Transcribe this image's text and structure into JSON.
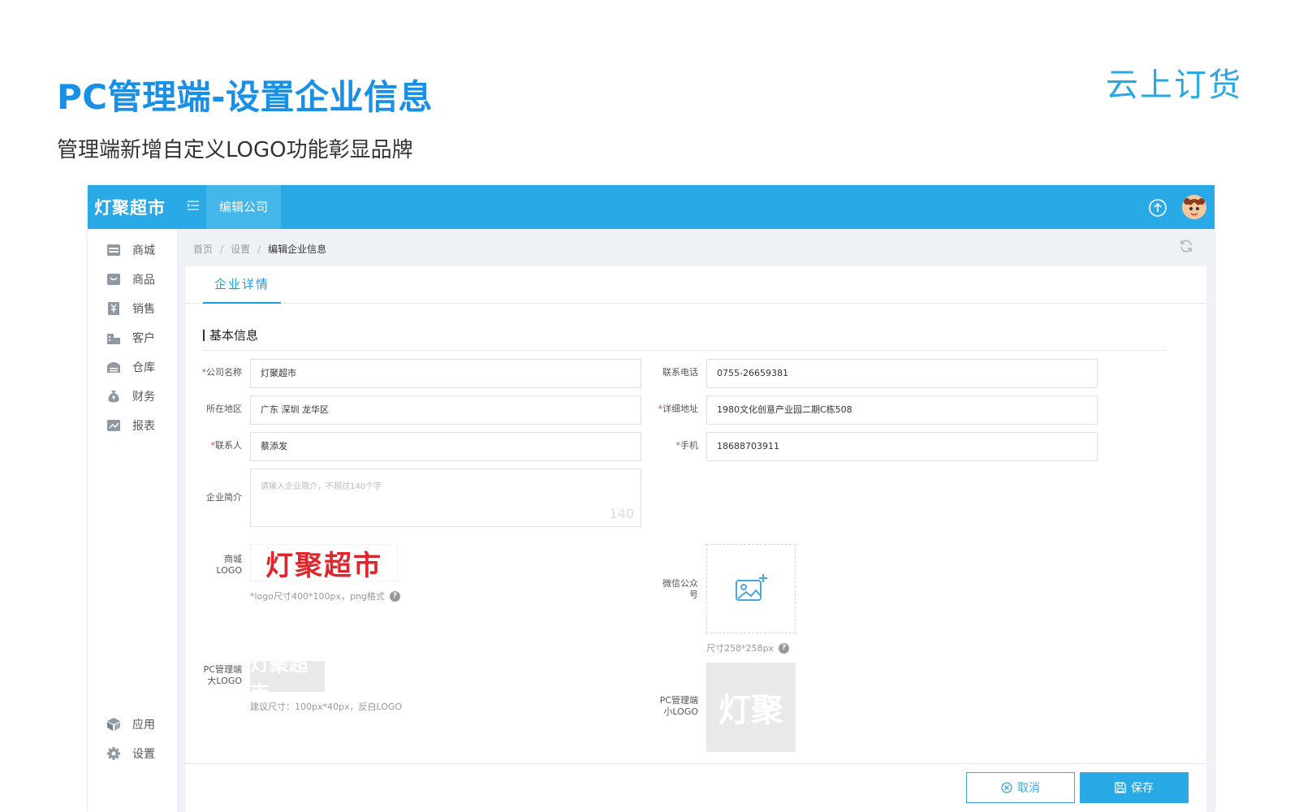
{
  "slide": {
    "title": "PC管理端-设置企业信息",
    "subtitle": "管理端新增自定义LOGO功能彰显品牌",
    "brand": "云上订货"
  },
  "topbar": {
    "app_name": "灯聚超市",
    "active_tab": "编辑公司"
  },
  "sidebar": {
    "items": [
      {
        "label": "商城",
        "icon": "shop-icon"
      },
      {
        "label": "商品",
        "icon": "goods-icon"
      },
      {
        "label": "销售",
        "icon": "sales-icon"
      },
      {
        "label": "客户",
        "icon": "customer-icon"
      },
      {
        "label": "仓库",
        "icon": "warehouse-icon"
      },
      {
        "label": "财务",
        "icon": "finance-icon"
      },
      {
        "label": "报表",
        "icon": "report-icon"
      }
    ],
    "bottom_items": [
      {
        "label": "应用",
        "icon": "apps-icon"
      },
      {
        "label": "设置",
        "icon": "settings-icon"
      }
    ]
  },
  "breadcrumb": {
    "home": "首页",
    "settings": "设置",
    "current": "编辑企业信息"
  },
  "tabs": {
    "detail": "企业详情"
  },
  "section": {
    "title": "基本信息"
  },
  "form": {
    "company_name": {
      "label": "公司名称",
      "value": "灯聚超市",
      "required": "*"
    },
    "phone": {
      "label": "联系电话",
      "value": "0755-26659381"
    },
    "region": {
      "label": "所在地区",
      "value": "广东 深圳 龙华区"
    },
    "address": {
      "label": "详细地址",
      "value": "1980文化创意产业园二期C栋508",
      "required": "*"
    },
    "contact": {
      "label": "联系人",
      "value": "蔡添发",
      "required": "*"
    },
    "mobile": {
      "label": "手机",
      "value": "18688703911",
      "required": "*"
    },
    "intro": {
      "label": "企业简介",
      "placeholder": "请输入企业简介，不超过140个字",
      "counter": "140"
    },
    "shop_logo": {
      "label_line1": "商城",
      "label_line2": "LOGO",
      "logo_text": "灯聚超市",
      "hint": "*logo尺寸400*100px，png格式"
    },
    "wechat": {
      "label_line1": "微信公众",
      "label_line2": "号",
      "hint": "尺寸258*258px"
    },
    "pc_big_logo": {
      "label_line1": "PC管理端",
      "label_line2": "大LOGO",
      "logo_text": "灯聚超市",
      "hint": "建议尺寸：100px*40px，反白LOGO"
    },
    "pc_small_logo": {
      "label_line1": "PC管理端",
      "label_line2": "小LOGO",
      "logo_text": "灯聚"
    }
  },
  "buttons": {
    "cancel": "取消",
    "save": "保存"
  },
  "colors": {
    "topbar": "#29a9e5",
    "title": "#1a8fe6",
    "logo_red": "#e0262d",
    "required": "#e2423c"
  }
}
